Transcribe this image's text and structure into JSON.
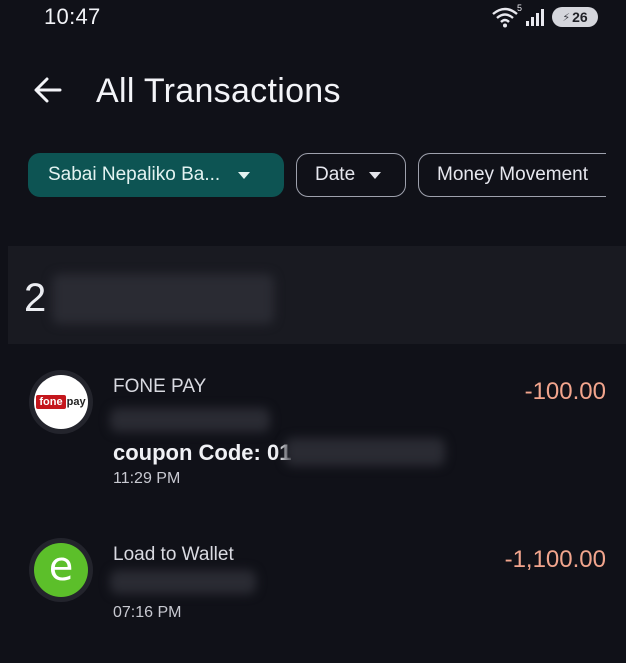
{
  "status_bar": {
    "time": "10:47",
    "wifi_badge": "5",
    "battery": "26",
    "icons": [
      "wifi-icon",
      "signal-icon",
      "battery-icon"
    ]
  },
  "header": {
    "back_icon": "arrow-left-icon",
    "title": "All Transactions"
  },
  "filters": {
    "bank": "Sabai Nepaliko Ba...",
    "date": "Date",
    "money_movement": "Money Movement"
  },
  "date_section": {
    "visible_text": "2"
  },
  "transactions": [
    {
      "name": "FONE PAY",
      "amount": "-100.00",
      "coupon": "coupon Code: 01",
      "time": "11:29 PM",
      "logo": "fonepay-logo"
    },
    {
      "name": "Load to Wallet",
      "amount": "-1,100.00",
      "time": "07:16 PM",
      "logo": "esewa-logo"
    }
  ],
  "colors": {
    "background": "#101118",
    "accent_chip": "#0d5453",
    "debit_amount": "#f2a58d"
  }
}
